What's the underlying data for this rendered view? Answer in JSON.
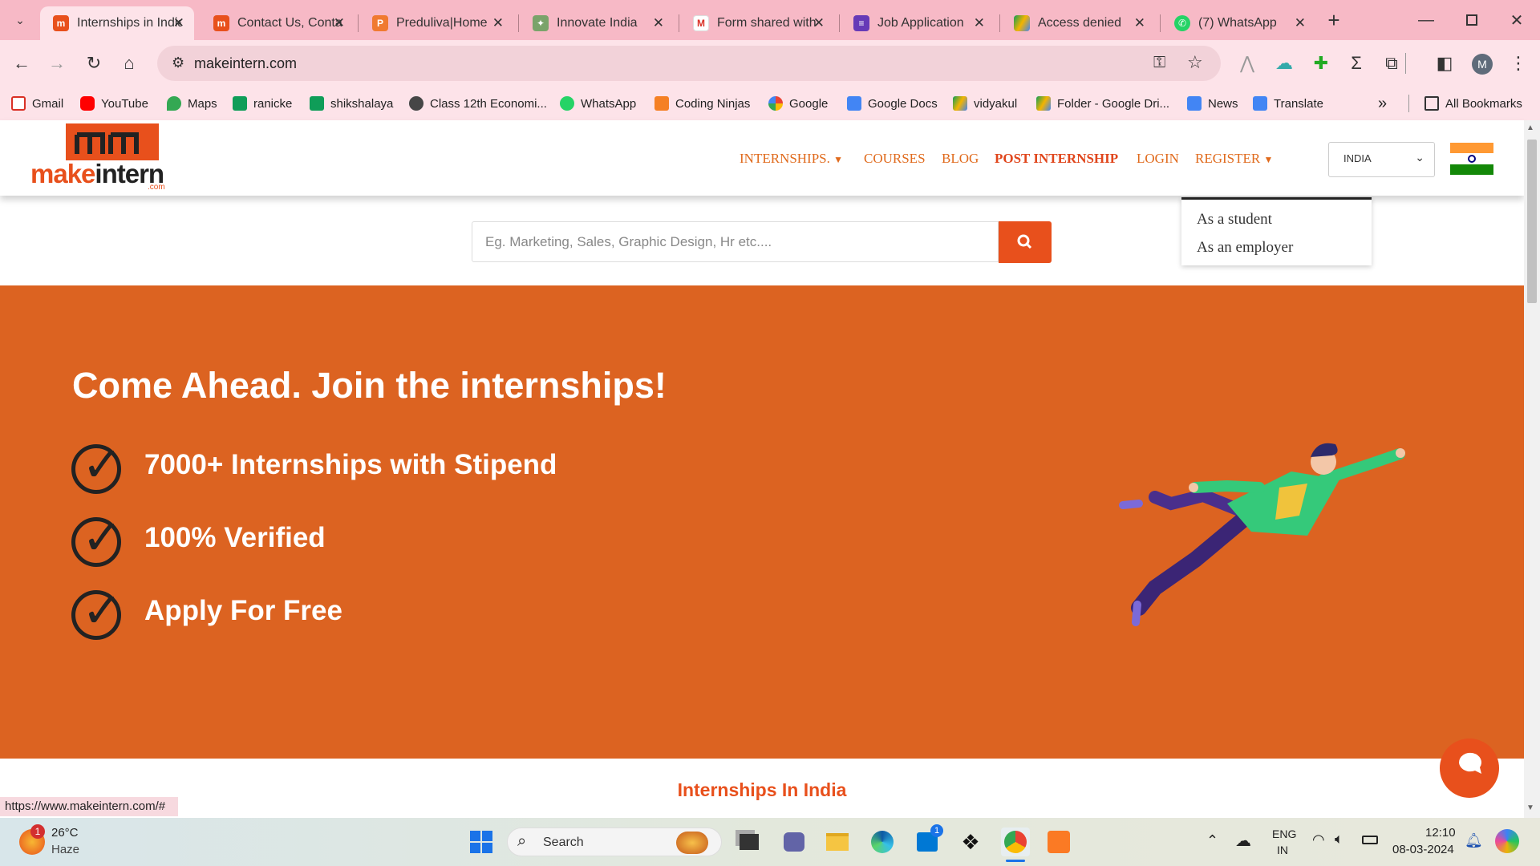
{
  "browser": {
    "tabs": [
      {
        "title": "Internships in India",
        "active": true
      },
      {
        "title": "Contact Us, Contact"
      },
      {
        "title": "Preduliva|Home"
      },
      {
        "title": "Innovate India"
      },
      {
        "title": "Form shared with"
      },
      {
        "title": "Job Application"
      },
      {
        "title": "Access denied"
      },
      {
        "title": "(7) WhatsApp"
      }
    ],
    "url": "makeintern.com",
    "bookmarks": [
      "Gmail",
      "YouTube",
      "Maps",
      "ranicke",
      "shikshalaya",
      "Class 12th Economi...",
      "WhatsApp",
      "Coding Ninjas",
      "Google",
      "Google Docs",
      "vidyakul",
      "Folder - Google Dri...",
      "News",
      "Translate"
    ],
    "all_bookmarks_label": "All Bookmarks",
    "profile_initial": "M",
    "status_url": "https://www.makeintern.com/#"
  },
  "site": {
    "logo_text": "makeintern",
    "logo_suffix": ".com",
    "nav": {
      "internships": "INTERNSHIPS.",
      "courses": "COURSES",
      "blog": "BLOG",
      "post_internship": "POST INTERNSHIP",
      "login": "LOGIN",
      "register": "REGISTER"
    },
    "country_selected": "INDIA",
    "register_menu": [
      "As a student",
      "As an employer"
    ],
    "search_placeholder": "Eg. Marketing, Sales, Graphic Design, Hr etc....",
    "hero": {
      "title": "Come Ahead. Join the internships!",
      "features": [
        "7000+ Internships with Stipend",
        "100% Verified",
        "Apply For Free"
      ]
    },
    "section_title": "Internships In India"
  },
  "taskbar": {
    "weather_temp": "26°C",
    "weather_desc": "Haze",
    "weather_badge": "1",
    "search_label": "Search",
    "lang_top": "ENG",
    "lang_bottom": "IN",
    "time": "12:10",
    "date": "08-03-2024",
    "store_badge": "1"
  },
  "colors": {
    "brand": "#e8501c",
    "hero_bg": "#dc6321",
    "chrome_tab": "#f7b9c6"
  }
}
